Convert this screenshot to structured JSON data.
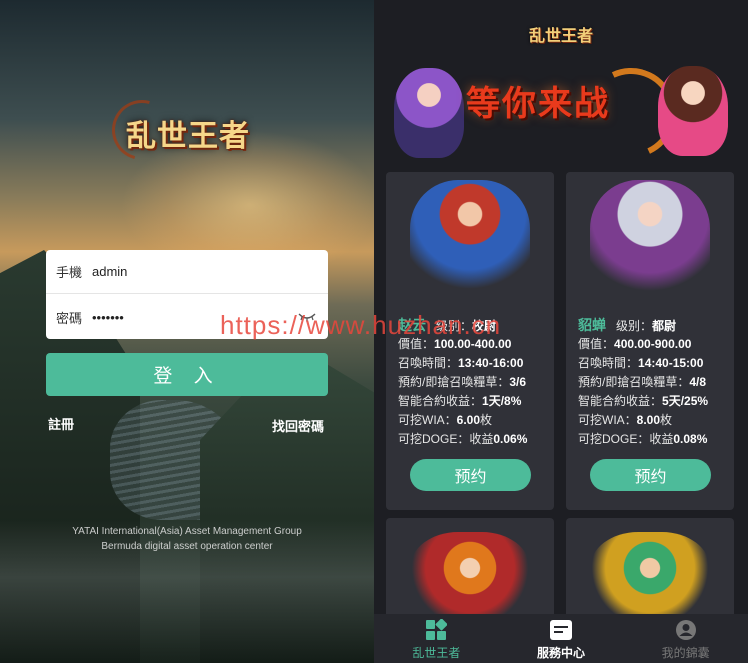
{
  "login": {
    "logo_text": "乱世王者",
    "phone_label": "手機",
    "phone_value": "admin",
    "password_label": "密碼",
    "password_value": "•••••••",
    "eye_icon": "eye-closed-icon",
    "submit_label": "登 入",
    "register_label": "註冊",
    "forgot_label": "找回密碼",
    "footer_line1": "YATAI International(Asia) Asset Management Group",
    "footer_line2": "Bermuda digital asset operation center"
  },
  "app": {
    "top_logo": "乱世王者",
    "banner_title": "等你来战",
    "cards": [
      {
        "name": "赵云",
        "rank_label": "级别：",
        "rank": "校尉",
        "price_label": "價值：",
        "price": "100.00-400.00",
        "time_label": "召喚時間：",
        "time": "13:40-16:00",
        "reserve_label": "預約/即搶召喚糧草：",
        "reserve": "3/6",
        "income_label": "智能合約收益：",
        "income": "1天/8%",
        "wia_label": "可挖WIA：",
        "wia": "6.00",
        "wia_unit": "枚",
        "doge_label": "可挖DOGE：收益",
        "doge": "0.06%",
        "button": "预约"
      },
      {
        "name": "貂蝉",
        "rank_label": "级别：",
        "rank": "都尉",
        "price_label": "價值：",
        "price": "400.00-900.00",
        "time_label": "召喚時間：",
        "time": "14:40-15:00",
        "reserve_label": "預約/即搶召喚糧草：",
        "reserve": "4/8",
        "income_label": "智能合約收益：",
        "income": "5天/25%",
        "wia_label": "可挖WIA：",
        "wia": "8.00",
        "wia_unit": "枚",
        "doge_label": "可挖DOGE：收益",
        "doge": "0.08%",
        "button": "预约"
      }
    ],
    "tabs": [
      {
        "label": "乱世王者",
        "icon": "grid-icon"
      },
      {
        "label": "服務中心",
        "icon": "service-card-icon"
      },
      {
        "label": "我的錦囊",
        "icon": "user-icon"
      }
    ],
    "accent_color": "#4dbb9a"
  },
  "watermark": "https://www.huzhan.cn"
}
